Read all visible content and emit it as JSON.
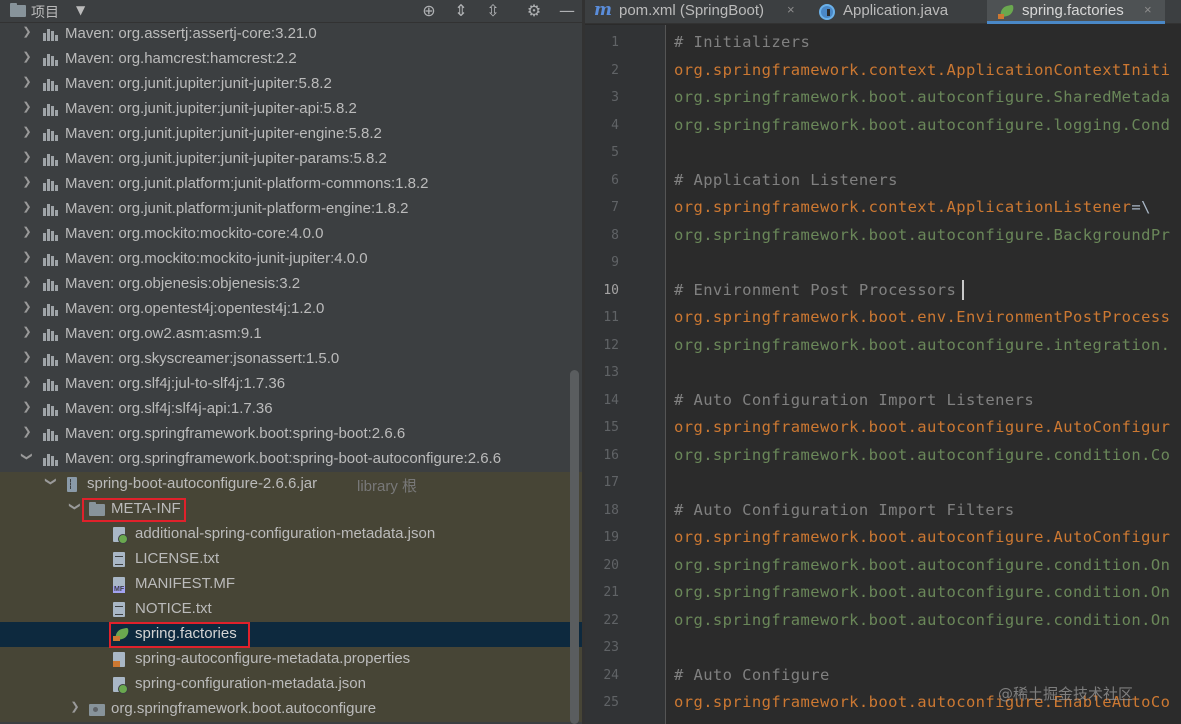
{
  "project_panel": {
    "title": "项目",
    "tree": [
      {
        "label": "Maven: org.assertj:assertj-core:3.21.0",
        "icon": "library-icon",
        "arrow": "›",
        "hint": ""
      },
      {
        "label": "Maven: org.hamcrest:hamcrest:2.2",
        "icon": "library-icon",
        "arrow": "›",
        "hint": ""
      },
      {
        "label": "Maven: org.junit.jupiter:junit-jupiter:5.8.2",
        "icon": "library-icon",
        "arrow": "›",
        "hint": ""
      },
      {
        "label": "Maven: org.junit.jupiter:junit-jupiter-api:5.8.2",
        "icon": "library-icon",
        "arrow": "›",
        "hint": ""
      },
      {
        "label": "Maven: org.junit.jupiter:junit-jupiter-engine:5.8.2",
        "icon": "library-icon",
        "arrow": "›",
        "hint": ""
      },
      {
        "label": "Maven: org.junit.jupiter:junit-jupiter-params:5.8.2",
        "icon": "library-icon",
        "arrow": "›",
        "hint": ""
      },
      {
        "label": "Maven: org.junit.platform:junit-platform-commons:1.8.2",
        "icon": "library-icon",
        "arrow": "›",
        "hint": ""
      },
      {
        "label": "Maven: org.junit.platform:junit-platform-engine:1.8.2",
        "icon": "library-icon",
        "arrow": "›",
        "hint": ""
      },
      {
        "label": "Maven: org.mockito:mockito-core:4.0.0",
        "icon": "library-icon",
        "arrow": "›",
        "hint": ""
      },
      {
        "label": "Maven: org.mockito:mockito-junit-jupiter:4.0.0",
        "icon": "library-icon",
        "arrow": "›",
        "hint": ""
      },
      {
        "label": "Maven: org.objenesis:objenesis:3.2",
        "icon": "library-icon",
        "arrow": "›",
        "hint": ""
      },
      {
        "label": "Maven: org.opentest4j:opentest4j:1.2.0",
        "icon": "library-icon",
        "arrow": "›",
        "hint": ""
      },
      {
        "label": "Maven: org.ow2.asm:asm:9.1",
        "icon": "library-icon",
        "arrow": "›",
        "hint": ""
      },
      {
        "label": "Maven: org.skyscreamer:jsonassert:1.5.0",
        "icon": "library-icon",
        "arrow": "›",
        "hint": ""
      },
      {
        "label": "Maven: org.slf4j:jul-to-slf4j:1.7.36",
        "icon": "library-icon",
        "arrow": "›",
        "hint": ""
      },
      {
        "label": "Maven: org.slf4j:slf4j-api:1.7.36",
        "icon": "library-icon",
        "arrow": "›",
        "hint": ""
      },
      {
        "label": "Maven: org.springframework.boot:spring-boot:2.6.6",
        "icon": "library-icon",
        "arrow": "›",
        "hint": ""
      },
      {
        "label": "Maven: org.springframework.boot:spring-boot-autoconfigure:2.6.6",
        "icon": "library-icon",
        "arrow": "⌄",
        "hint": ""
      },
      {
        "label": "spring-boot-autoconfigure-2.6.6.jar",
        "icon": "jar-icon",
        "arrow": "⌄",
        "hint": "library 根"
      },
      {
        "label": "META-INF",
        "icon": "folder-icon",
        "arrow": "⌄",
        "hint": ""
      },
      {
        "label": "additional-spring-configuration-metadata.json",
        "icon": "json-file-icon",
        "arrow": "",
        "hint": ""
      },
      {
        "label": "LICENSE.txt",
        "icon": "text-file-icon",
        "arrow": "",
        "hint": ""
      },
      {
        "label": "MANIFEST.MF",
        "icon": "manifest-file-icon",
        "arrow": "",
        "hint": ""
      },
      {
        "label": "NOTICE.txt",
        "icon": "text-file-icon",
        "arrow": "",
        "hint": ""
      },
      {
        "label": "spring.factories",
        "icon": "spring-factories-icon",
        "arrow": "",
        "hint": ""
      },
      {
        "label": "spring-autoconfigure-metadata.properties",
        "icon": "properties-file-icon",
        "arrow": "",
        "hint": ""
      },
      {
        "label": "spring-configuration-metadata.json",
        "icon": "json-file-icon",
        "arrow": "",
        "hint": ""
      },
      {
        "label": "org.springframework.boot.autoconfigure",
        "icon": "package-icon",
        "arrow": "›",
        "hint": ""
      }
    ]
  },
  "tabs": [
    {
      "label": "pom.xml (SpringBoot)",
      "icon": "maven-icon",
      "active": false
    },
    {
      "label": "Application.java",
      "icon": "java-class-icon",
      "active": false
    },
    {
      "label": "spring.factories",
      "icon": "spring-factories-icon",
      "active": true
    }
  ],
  "tab_close": "×",
  "editor": {
    "current_line": 10,
    "lines": [
      {
        "n": "1",
        "kind": "comment",
        "text": "# Initializers"
      },
      {
        "n": "2",
        "kind": "key",
        "text": "org.springframework.context.ApplicationContextIniti",
        "tail": ""
      },
      {
        "n": "3",
        "kind": "val",
        "text": "org.springframework.boot.autoconfigure.SharedMetada"
      },
      {
        "n": "4",
        "kind": "val",
        "text": "org.springframework.boot.autoconfigure.logging.Cond"
      },
      {
        "n": "5",
        "kind": "blank",
        "text": ""
      },
      {
        "n": "6",
        "kind": "comment",
        "text": "# Application Listeners"
      },
      {
        "n": "7",
        "kind": "key",
        "text": "org.springframework.context.ApplicationListener",
        "tail": "=\\"
      },
      {
        "n": "8",
        "kind": "val",
        "text": "org.springframework.boot.autoconfigure.BackgroundPr"
      },
      {
        "n": "9",
        "kind": "blank",
        "text": ""
      },
      {
        "n": "10",
        "kind": "comment",
        "text": "# Environment Post Processors"
      },
      {
        "n": "11",
        "kind": "key",
        "text": "org.springframework.boot.env.EnvironmentPostProcess",
        "tail": ""
      },
      {
        "n": "12",
        "kind": "val",
        "text": "org.springframework.boot.autoconfigure.integration."
      },
      {
        "n": "13",
        "kind": "blank",
        "text": ""
      },
      {
        "n": "14",
        "kind": "comment",
        "text": "# Auto Configuration Import Listeners"
      },
      {
        "n": "15",
        "kind": "key",
        "text": "org.springframework.boot.autoconfigure.AutoConfigur",
        "tail": ""
      },
      {
        "n": "16",
        "kind": "val",
        "text": "org.springframework.boot.autoconfigure.condition.Co"
      },
      {
        "n": "17",
        "kind": "blank",
        "text": ""
      },
      {
        "n": "18",
        "kind": "comment",
        "text": "# Auto Configuration Import Filters"
      },
      {
        "n": "19",
        "kind": "key",
        "text": "org.springframework.boot.autoconfigure.AutoConfigur",
        "tail": ""
      },
      {
        "n": "20",
        "kind": "val",
        "text": "org.springframework.boot.autoconfigure.condition.On"
      },
      {
        "n": "21",
        "kind": "val",
        "text": "org.springframework.boot.autoconfigure.condition.On"
      },
      {
        "n": "22",
        "kind": "val",
        "text": "org.springframework.boot.autoconfigure.condition.On"
      },
      {
        "n": "23",
        "kind": "blank",
        "text": ""
      },
      {
        "n": "24",
        "kind": "comment",
        "text": "# Auto Configure"
      },
      {
        "n": "25",
        "kind": "key",
        "text": "org.springframework.boot.autoconfigure.EnableAutoCo",
        "tail": ""
      }
    ]
  },
  "watermark": "@稀土掘金技术社区",
  "colors": {
    "comment": "#808080",
    "key": "#cc7832",
    "value": "#6a8759",
    "selection": "#0d293e",
    "highlight_box": "#e0212b"
  }
}
